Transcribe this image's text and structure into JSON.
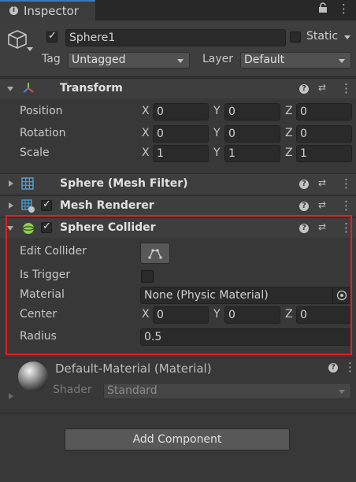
{
  "tab": {
    "icon": "info-icon",
    "label": "Inspector",
    "lock_icon": "lock-icon",
    "menu_icon": "kebab-menu-icon"
  },
  "object": {
    "name": "Sphere1",
    "static_label": "Static",
    "tag_label": "Tag",
    "tag_value": "Untagged",
    "layer_label": "Layer",
    "layer_value": "Default"
  },
  "transform": {
    "title": "Transform",
    "position": {
      "label": "Position",
      "x": "0",
      "y": "0",
      "z": "0"
    },
    "rotation": {
      "label": "Rotation",
      "x": "0",
      "y": "0",
      "z": "0"
    },
    "scale": {
      "label": "Scale",
      "x": "1",
      "y": "1",
      "z": "1"
    }
  },
  "axes": {
    "x": "X",
    "y": "Y",
    "z": "Z"
  },
  "mesh_filter": {
    "title": "Sphere (Mesh Filter)"
  },
  "mesh_renderer": {
    "title": "Mesh Renderer"
  },
  "sphere_collider": {
    "title": "Sphere Collider",
    "edit_collider_label": "Edit Collider",
    "is_trigger_label": "Is Trigger",
    "material_label": "Material",
    "material_value": "None (Physic Material)",
    "center_label": "Center",
    "center": {
      "x": "0",
      "y": "0",
      "z": "0"
    },
    "radius_label": "Radius",
    "radius_value": "0.5"
  },
  "material": {
    "title": "Default-Material (Material)",
    "shader_label": "Shader",
    "shader_value": "Standard"
  },
  "add_component_label": "Add Component",
  "highlight_color": "#e02020"
}
